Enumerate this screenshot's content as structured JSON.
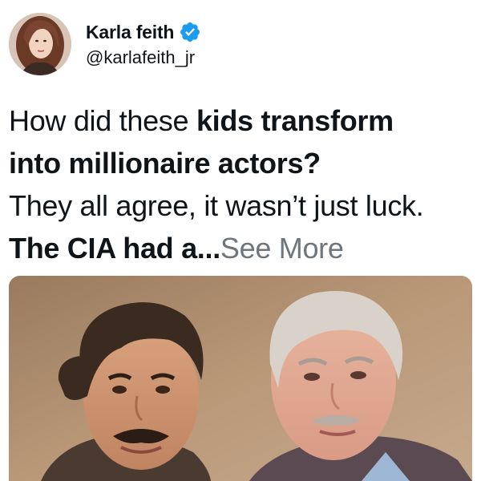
{
  "tweet": {
    "author": {
      "display_name": "Karla feith",
      "handle": "@karlafeith_jr",
      "verified_icon": "verified-badge-icon",
      "avatar_icon": "profile-avatar"
    },
    "body": {
      "line1_regular": "How did these ",
      "line1_bold": "kids transform",
      "line2_bold": "into millionaire actors?",
      "line3_regular": "They all agree, it wasn’t just luck.",
      "line4_bold": "The CIA had a",
      "line4_ellipsis": "...",
      "see_more": "See More"
    },
    "media": {
      "icon": "photo-two-men"
    }
  },
  "colors": {
    "text": "#0f1419",
    "muted": "#6e767d",
    "verified": "#1d9bf0"
  }
}
